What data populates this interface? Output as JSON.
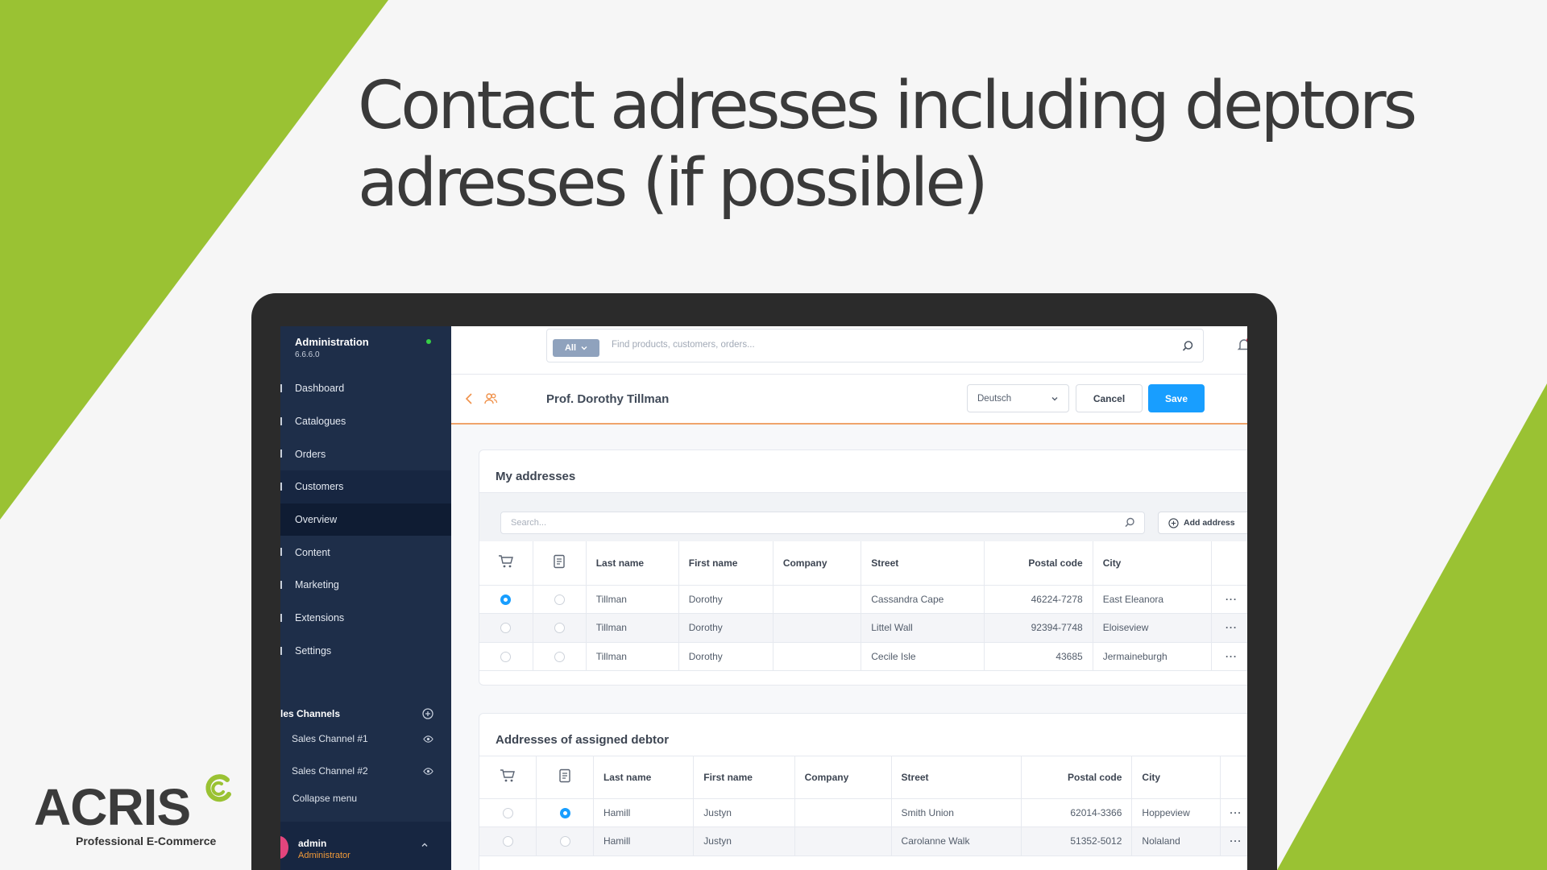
{
  "headline": {
    "line1": "Contact adresses including deptors",
    "line2": "adresses (if possible)"
  },
  "brand": {
    "logo_text": "ACRIS",
    "tagline": "Professional E-Commerce",
    "green": "#9ac233",
    "dark": "#3b3b3b"
  },
  "sidebar": {
    "title": "Administration",
    "version": "6.6.6.0",
    "nav": [
      {
        "label": "Dashboard",
        "state": ""
      },
      {
        "label": "Catalogues",
        "state": ""
      },
      {
        "label": "Orders",
        "state": ""
      },
      {
        "label": "Customers",
        "state": "active"
      },
      {
        "label": "Overview",
        "state": "sub"
      },
      {
        "label": "Content",
        "state": ""
      },
      {
        "label": "Marketing",
        "state": ""
      },
      {
        "label": "Extensions",
        "state": ""
      },
      {
        "label": "Settings",
        "state": ""
      }
    ],
    "channels_heading": "les Channels",
    "channels": [
      "Sales Channel #1",
      "Sales Channel #2"
    ],
    "collapse_label": "Collapse menu",
    "user": {
      "name": "admin",
      "role": "Administrator"
    }
  },
  "topbar": {
    "filter_label": "All",
    "search_placeholder": "Find products, customers, orders..."
  },
  "smartbar": {
    "title": "Prof. Dorothy Tillman",
    "language": "Deutsch",
    "cancel_label": "Cancel",
    "save_label": "Save"
  },
  "my_addresses": {
    "title": "My addresses",
    "search_placeholder": "Search...",
    "add_label": "Add address",
    "columns": [
      "Last name",
      "First name",
      "Company",
      "Street",
      "Postal code",
      "City"
    ],
    "rows": [
      {
        "shipping": true,
        "billing": false,
        "last": "Tillman",
        "first": "Dorothy",
        "company": "",
        "street": "Cassandra Cape",
        "postal": "46224-7278",
        "city": "East Eleanora"
      },
      {
        "shipping": false,
        "billing": false,
        "last": "Tillman",
        "first": "Dorothy",
        "company": "",
        "street": "Littel Wall",
        "postal": "92394-7748",
        "city": "Eloiseview"
      },
      {
        "shipping": false,
        "billing": false,
        "last": "Tillman",
        "first": "Dorothy",
        "company": "",
        "street": "Cecile Isle",
        "postal": "43685",
        "city": "Jermaineburgh"
      }
    ]
  },
  "debtor_addresses": {
    "title": "Addresses of assigned debtor",
    "columns": [
      "Last name",
      "First name",
      "Company",
      "Street",
      "Postal code",
      "City"
    ],
    "rows": [
      {
        "shipping": false,
        "billing": true,
        "last": "Hamill",
        "first": "Justyn",
        "company": "",
        "street": "Smith Union",
        "postal": "62014-3366",
        "city": "Hoppeview"
      },
      {
        "shipping": false,
        "billing": false,
        "last": "Hamill",
        "first": "Justyn",
        "company": "",
        "street": "Carolanne Walk",
        "postal": "51352-5012",
        "city": "Nolaland"
      }
    ]
  }
}
